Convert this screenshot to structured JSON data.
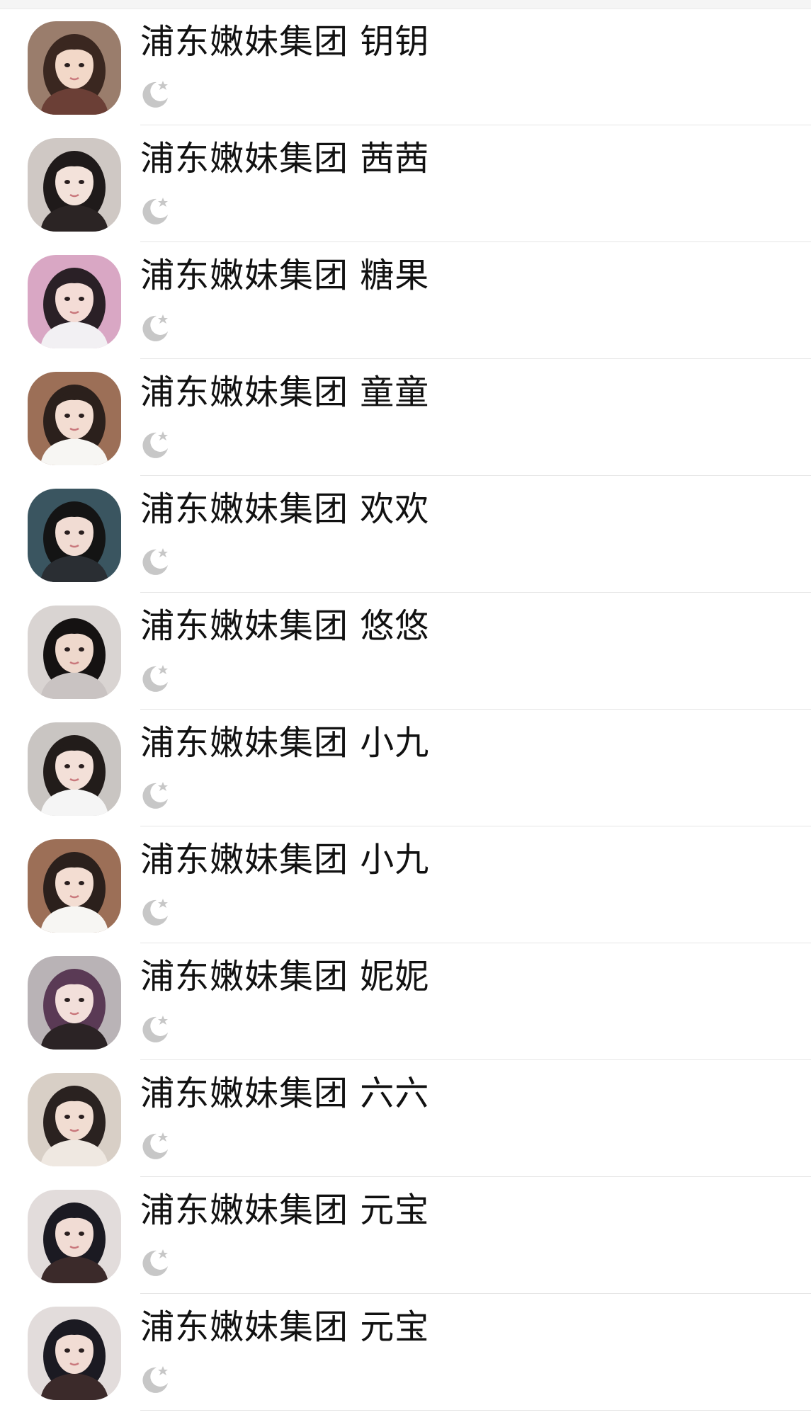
{
  "contacts": [
    {
      "name": "浦东嫩妹集团 钥钥",
      "status_icon": "moon-star-icon",
      "avatar": {
        "bg": "#9a7d6c",
        "hair": "#3a2720",
        "skin": "#f2d8c8",
        "clothes": "#6b3f36"
      }
    },
    {
      "name": "浦东嫩妹集团 茜茜",
      "status_icon": "moon-star-icon",
      "avatar": {
        "bg": "#cfc8c4",
        "hair": "#1f1a1a",
        "skin": "#f3e2da",
        "clothes": "#2b2424"
      }
    },
    {
      "name": "浦东嫩妹集团 糖果",
      "status_icon": "moon-star-icon",
      "avatar": {
        "bg": "#d9a7c4",
        "hair": "#2a2026",
        "skin": "#f4dcd6",
        "clothes": "#f2f0f3"
      }
    },
    {
      "name": "浦东嫩妹集团 童童",
      "status_icon": "moon-star-icon",
      "avatar": {
        "bg": "#9c6f57",
        "hair": "#2b201c",
        "skin": "#f3ddd2",
        "clothes": "#f7f6f3"
      }
    },
    {
      "name": "浦东嫩妹集团 欢欢",
      "status_icon": "moon-star-icon",
      "avatar": {
        "bg": "#3a5560",
        "hair": "#141414",
        "skin": "#f1dcd3",
        "clothes": "#2a2e33"
      }
    },
    {
      "name": "浦东嫩妹集团 悠悠",
      "status_icon": "moon-star-icon",
      "avatar": {
        "bg": "#d9d4d2",
        "hair": "#151212",
        "skin": "#eed8cc",
        "clothes": "#c9c3c2"
      }
    },
    {
      "name": "浦东嫩妹集团 小九",
      "status_icon": "moon-star-icon",
      "avatar": {
        "bg": "#c9c5c2",
        "hair": "#221c1a",
        "skin": "#f3e0d8",
        "clothes": "#f5f5f5"
      }
    },
    {
      "name": "浦东嫩妹集团 小九",
      "status_icon": "moon-star-icon",
      "avatar": {
        "bg": "#9c6f57",
        "hair": "#2b201c",
        "skin": "#f3ddd2",
        "clothes": "#f7f6f3"
      }
    },
    {
      "name": "浦东嫩妹集团 妮妮",
      "status_icon": "moon-star-icon",
      "avatar": {
        "bg": "#b9b3b6",
        "hair": "#5a3a55",
        "skin": "#f2dfda",
        "clothes": "#2b2325"
      }
    },
    {
      "name": "浦东嫩妹集团 六六",
      "status_icon": "moon-star-icon",
      "avatar": {
        "bg": "#d8cfc6",
        "hair": "#2a2220",
        "skin": "#f1ddd2",
        "clothes": "#efe8e1"
      }
    },
    {
      "name": "浦东嫩妹集团 元宝",
      "status_icon": "moon-star-icon",
      "avatar": {
        "bg": "#e2dcdb",
        "hair": "#1b1a22",
        "skin": "#f1dcd4",
        "clothes": "#3b2a2a"
      }
    },
    {
      "name": "浦东嫩妹集团 元宝",
      "status_icon": "moon-star-icon",
      "avatar": {
        "bg": "#e2dcdb",
        "hair": "#1b1a22",
        "skin": "#f1dcd4",
        "clothes": "#3b2a2a"
      }
    }
  ],
  "colors": {
    "name_text": "#111111",
    "moon_icon": "#c7c7c7",
    "divider": "#e6e6e6"
  }
}
